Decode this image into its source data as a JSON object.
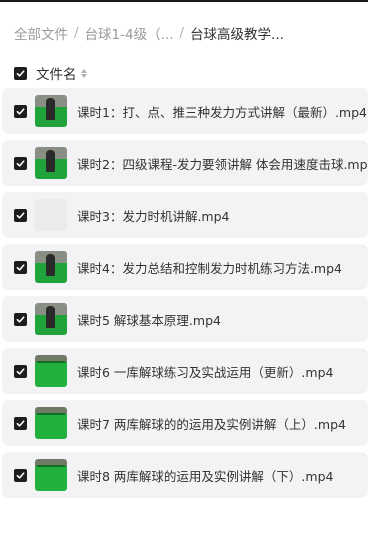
{
  "breadcrumb": {
    "items": [
      "全部文件",
      "台球1-4级（...",
      "台球高级教学..."
    ],
    "separator": "/"
  },
  "header": {
    "column_label": "文件名",
    "select_all_checked": true
  },
  "files": [
    {
      "name": "课时1：打、点、推三种发力方式讲解（最新）.mp4",
      "checked": true,
      "thumbnail": "player-icon"
    },
    {
      "name": "课时2：四级课程-发力要领讲解 体会用速度击球.mp4",
      "checked": true,
      "thumbnail": "player-icon"
    },
    {
      "name": "课时3：发力时机讲解.mp4",
      "checked": true,
      "thumbnail": "placeholder-icon"
    },
    {
      "name": "课时4：发力总结和控制发力时机练习方法.mp4",
      "checked": true,
      "thumbnail": "player-icon"
    },
    {
      "name": "课时5 解球基本原理.mp4",
      "checked": true,
      "thumbnail": "player-icon"
    },
    {
      "name": "课时6 一库解球练习及实战运用（更新）.mp4",
      "checked": true,
      "thumbnail": "table-icon"
    },
    {
      "name": "课时7 两库解球的的运用及实例讲解（上）.mp4",
      "checked": true,
      "thumbnail": "table-icon"
    },
    {
      "name": "课时8 两库解球的运用及实例讲解（下）.mp4",
      "checked": true,
      "thumbnail": "table-icon"
    }
  ],
  "colors": {
    "checkbox": "#1d1d1f",
    "row_background": "#f3f3f5",
    "felt": "#1fa33a"
  }
}
